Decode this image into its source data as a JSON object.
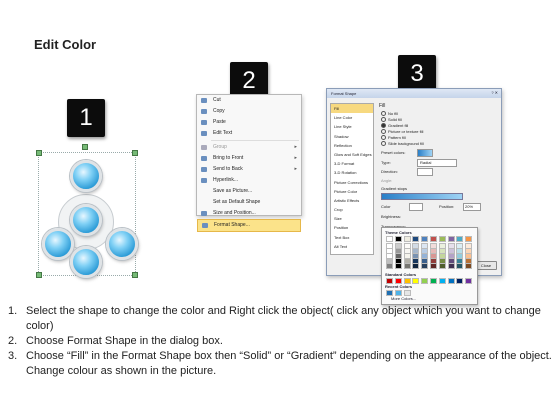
{
  "title": "Edit Color",
  "badges": [
    "1",
    "2",
    "3"
  ],
  "context_menu": {
    "items": [
      {
        "label": "Cut",
        "state": "normal"
      },
      {
        "label": "Copy",
        "state": "normal"
      },
      {
        "label": "Paste",
        "state": "normal"
      },
      {
        "label": "Edit Text",
        "state": "normal"
      },
      {
        "label": "Group",
        "state": "dim",
        "submenu": true
      },
      {
        "label": "Bring to Front",
        "state": "normal",
        "submenu": true
      },
      {
        "label": "Send to Back",
        "state": "normal",
        "submenu": true
      },
      {
        "label": "Hyperlink...",
        "state": "normal"
      },
      {
        "label": "Save as Picture...",
        "state": "normal"
      },
      {
        "label": "Set as Default Shape",
        "state": "normal"
      },
      {
        "label": "Size and Position...",
        "state": "normal"
      },
      {
        "label": "Format Shape...",
        "state": "highlight"
      }
    ]
  },
  "format_dialog": {
    "title": "Format Shape",
    "sidebar": [
      "Fill",
      "Line Color",
      "Line Style",
      "Shadow",
      "Reflection",
      "Glow and Soft Edges",
      "3-D Format",
      "3-D Rotation",
      "Picture Corrections",
      "Picture Color",
      "Artistic Effects",
      "Crop",
      "Size",
      "Position",
      "Text Box",
      "Alt Text"
    ],
    "section_title": "Fill",
    "fill_options": [
      "No fill",
      "Solid fill",
      "Gradient fill",
      "Picture or texture fill",
      "Pattern fill",
      "Slide background fill"
    ],
    "fill_selected": "Gradient fill",
    "preset_colors_label": "Preset colors:",
    "type_label": "Type:",
    "type_value": "Radial",
    "direction_label": "Direction:",
    "angle_label": "Angle:",
    "gradient_stops_label": "Gradient stops",
    "color_label": "Color",
    "position_label": "Position:",
    "position_value": "20%",
    "brightness_label": "Brightness:",
    "transparency_label": "Transparency:",
    "rotate_label": "Rotate with shape",
    "close_label": "Close"
  },
  "palette": {
    "theme_title": "Theme Colors",
    "standard_title": "Standard Colors",
    "recent_title": "Recent Colors",
    "more_label": "More Colors...",
    "theme_top": [
      "#ffffff",
      "#000000",
      "#eeece1",
      "#1f497d",
      "#4f81bd",
      "#c0504d",
      "#9bbb59",
      "#8064a2",
      "#4bacc6",
      "#f79646"
    ],
    "standard": [
      "#c00000",
      "#ff0000",
      "#ffc000",
      "#ffff00",
      "#92d050",
      "#00b050",
      "#00b0f0",
      "#0070c0",
      "#002060",
      "#7030a0"
    ],
    "recent": [
      "#1f6fb2",
      "#4fb3e8",
      "#e6e6e6"
    ]
  },
  "steps": [
    {
      "num": "1.",
      "text": "Select the shape to change the color and Right click the object( click any object which you want to change color)"
    },
    {
      "num": "2.",
      "text": "Choose Format Shape in the dialog box."
    },
    {
      "num": "3.",
      "text": "Choose “Fill” in the Format Shape box then “Solid” or “Gradient” depending on the appearance of the object. Change colour as shown in the picture."
    }
  ]
}
